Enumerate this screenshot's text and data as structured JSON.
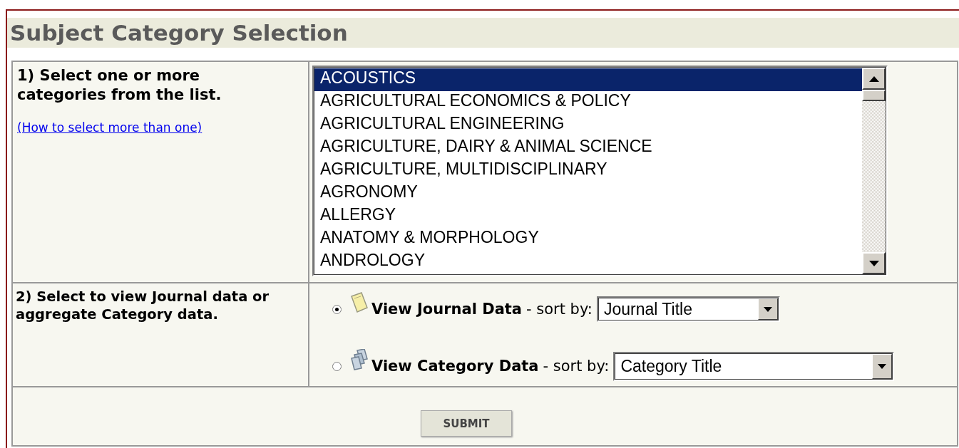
{
  "title": "Subject Category Selection",
  "step1": {
    "label": "1) Select one or more categories from the list.",
    "help_link": "(How to select more than one)"
  },
  "categories": [
    {
      "label": "ACOUSTICS",
      "selected": true
    },
    {
      "label": "AGRICULTURAL ECONOMICS & POLICY",
      "selected": false
    },
    {
      "label": "AGRICULTURAL ENGINEERING",
      "selected": false
    },
    {
      "label": "AGRICULTURE, DAIRY & ANIMAL SCIENCE",
      "selected": false
    },
    {
      "label": "AGRICULTURE, MULTIDISCIPLINARY",
      "selected": false
    },
    {
      "label": "AGRONOMY",
      "selected": false
    },
    {
      "label": "ALLERGY",
      "selected": false
    },
    {
      "label": "ANATOMY & MORPHOLOGY",
      "selected": false
    },
    {
      "label": "ANDROLOGY",
      "selected": false
    }
  ],
  "step2": {
    "label": "2) Select to view Journal data or aggregate Category data."
  },
  "view_options": [
    {
      "kind": "journal",
      "label": "View Journal Data",
      "sort_label": "- sort by:",
      "sort_value": "Journal Title",
      "selected": true
    },
    {
      "kind": "category",
      "label": "View Category Data",
      "sort_label": "- sort by:",
      "sort_value": "Category Title",
      "selected": false
    }
  ],
  "submit": "SUBMIT"
}
